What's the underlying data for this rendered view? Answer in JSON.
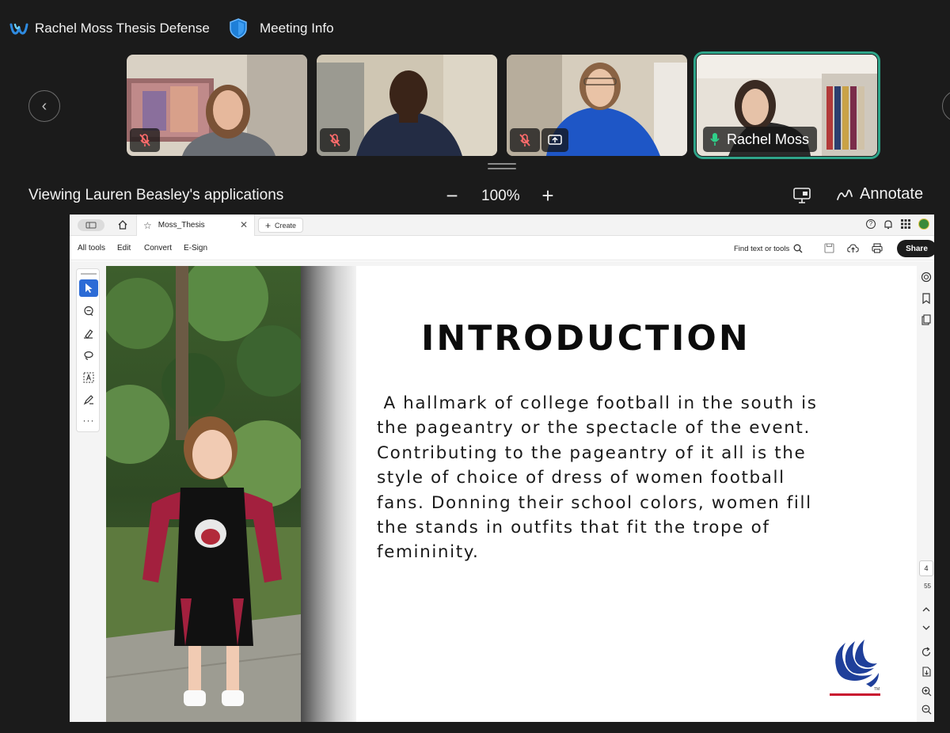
{
  "meeting": {
    "title": "Rachel Moss Thesis Defense",
    "info_label": "Meeting Info"
  },
  "participants": [
    {
      "muted": true
    },
    {
      "muted": true
    },
    {
      "muted": true,
      "sharing": true
    },
    {
      "name": "Rachel Moss",
      "active_speaker": true
    }
  ],
  "viewbar": {
    "title": "Viewing Lauren Beasley's applications",
    "zoom": "100%",
    "zoom_out": "−",
    "zoom_in": "+",
    "annotate_label": "Annotate"
  },
  "acrobat": {
    "tab_title": "Moss_Thesis",
    "create_label": "Create",
    "menu": [
      "All tools",
      "Edit",
      "Convert",
      "E-Sign"
    ],
    "find_label": "Find text or tools",
    "share_label": "Share",
    "current_page": "4",
    "page_total_fragment": "55"
  },
  "slide": {
    "heading": "INTRODUCTION",
    "body": " A hallmark of college football in the south is\nthe pageantry or the spectacle of the event.\nContributing to the pageantry of it all is the\nstyle of choice of dress of women football\nfans. Donning their school colors, women fill\nthe stands in outfits that fit the trope of\nfemininity.",
    "logo_mark": "TM"
  },
  "colors": {
    "active_outline": "#2fa58a",
    "logo_blue": "#1f3f9a",
    "logo_red": "#c8102e",
    "select_blue": "#2c6bd6"
  }
}
